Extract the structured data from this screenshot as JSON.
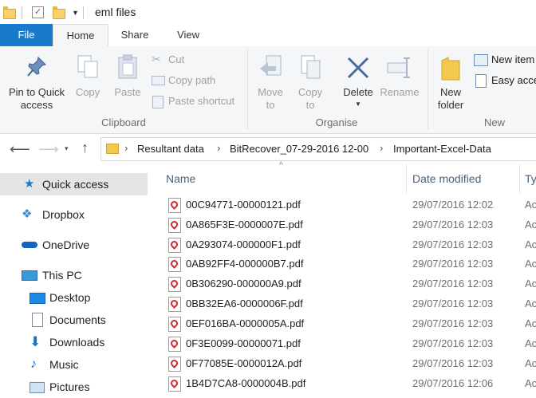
{
  "window": {
    "title": "eml files"
  },
  "ribbon_tabs": [
    {
      "label": "File"
    },
    {
      "label": "Home"
    },
    {
      "label": "Share"
    },
    {
      "label": "View"
    }
  ],
  "ribbon": {
    "clipboard": {
      "pin_label_line1": "Pin to Quick",
      "pin_label_line2": "access",
      "copy": "Copy",
      "paste": "Paste",
      "cut": "Cut",
      "copy_path": "Copy path",
      "paste_shortcut": "Paste shortcut",
      "group": "Clipboard"
    },
    "organise": {
      "move_to_line1": "Move",
      "move_to_line2": "to",
      "copy_to_line1": "Copy",
      "copy_to_line2": "to",
      "delete": "Delete",
      "rename": "Rename",
      "group": "Organise"
    },
    "new": {
      "new_folder_line1": "New",
      "new_folder_line2": "folder",
      "new_item": "New item",
      "easy_access": "Easy access",
      "group": "New"
    }
  },
  "address": {
    "crumbs": [
      "Resultant data",
      "BitRecover_07-29-2016 12-00",
      "Important-Excel-Data"
    ]
  },
  "nav": [
    {
      "label": "Quick access"
    },
    {
      "label": "Dropbox"
    },
    {
      "label": "OneDrive"
    },
    {
      "label": "This PC"
    },
    {
      "label": "Desktop"
    },
    {
      "label": "Documents"
    },
    {
      "label": "Downloads"
    },
    {
      "label": "Music"
    },
    {
      "label": "Pictures"
    }
  ],
  "columns": {
    "name": "Name",
    "date": "Date modified",
    "type": "Ty"
  },
  "files": [
    {
      "name": "00C94771-00000121.pdf",
      "date": "29/07/2016 12:02",
      "type": "Ac"
    },
    {
      "name": "0A865F3E-0000007E.pdf",
      "date": "29/07/2016 12:03",
      "type": "Ac"
    },
    {
      "name": "0A293074-000000F1.pdf",
      "date": "29/07/2016 12:03",
      "type": "Ac"
    },
    {
      "name": "0AB92FF4-000000B7.pdf",
      "date": "29/07/2016 12:03",
      "type": "Ac"
    },
    {
      "name": "0B306290-000000A9.pdf",
      "date": "29/07/2016 12:03",
      "type": "Ac"
    },
    {
      "name": "0BB32EA6-0000006F.pdf",
      "date": "29/07/2016 12:03",
      "type": "Ac"
    },
    {
      "name": "0EF016BA-0000005A.pdf",
      "date": "29/07/2016 12:03",
      "type": "Ac"
    },
    {
      "name": "0F3E0099-00000071.pdf",
      "date": "29/07/2016 12:03",
      "type": "Ac"
    },
    {
      "name": "0F77085E-0000012A.pdf",
      "date": "29/07/2016 12:03",
      "type": "Ac"
    },
    {
      "name": "1B4D7CA8-0000004B.pdf",
      "date": "29/07/2016 12:06",
      "type": "Ac"
    }
  ],
  "colors": {
    "accent": "#1979ca",
    "folder": "#f7d26a",
    "pdf": "#d0262e",
    "selection": "#e5e5e5"
  }
}
